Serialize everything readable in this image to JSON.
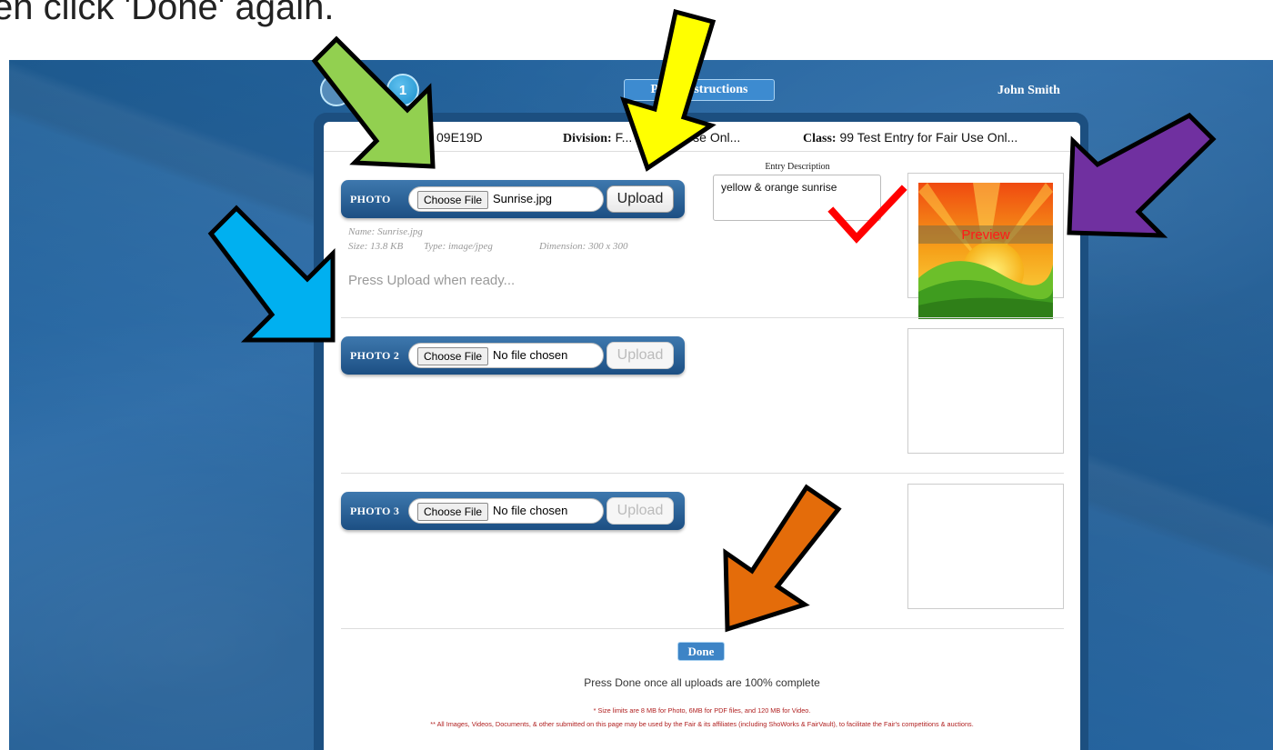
{
  "caption": "en click 'Done' again.",
  "header": {
    "step_number": "1",
    "instructions_button": "Print Instructions",
    "user_name": "John Smith"
  },
  "entry": {
    "en_label": "EN:",
    "en_value": "09E19D",
    "division_label": "Division:",
    "division_value": "F... For Fair Use Onl...",
    "class_label": "Class:",
    "class_value": "99 Test Entry for Fair Use Onl..."
  },
  "description": {
    "label": "Entry Description",
    "value": "yellow & orange sunrise"
  },
  "photos": [
    {
      "label": "PHOTO",
      "choose_label": "Choose File",
      "file_name": "Sunrise.jpg",
      "upload_label": "Upload",
      "upload_enabled": true,
      "name_line": "Name: Sunrise.jpg",
      "size_line": "Size: 13.8 KB",
      "type_line": "Type: image/jpeg",
      "dimension_line": "Dimension: 300 x 300",
      "status": "Press Upload when ready...",
      "preview_label": "Preview"
    },
    {
      "label": "PHOTO 2",
      "choose_label": "Choose File",
      "file_name": "No file chosen",
      "upload_label": "Upload",
      "upload_enabled": false
    },
    {
      "label": "PHOTO 3",
      "choose_label": "Choose File",
      "file_name": "No file chosen",
      "upload_label": "Upload",
      "upload_enabled": false
    }
  ],
  "footer": {
    "done_label": "Done",
    "done_message": "Press Done once all uploads are 100% complete",
    "size_note": "* Size limits are 8 MB for Photo, 6MB for PDF files, and 120 MB for Video.",
    "usage_note": "** All Images, Videos, Documents, & other submitted on this page may be used by the Fair & its affiliates (including ShoWorks & FairVault), to facilitate the Fair's competitions & auctions."
  },
  "annotations": {
    "arrow_colors": {
      "green": "#92d050",
      "yellow": "#ffff00",
      "blue": "#00b0f0",
      "purple": "#7030a0",
      "orange": "#e46c0a"
    },
    "checkmark_color": "#ff0000"
  }
}
